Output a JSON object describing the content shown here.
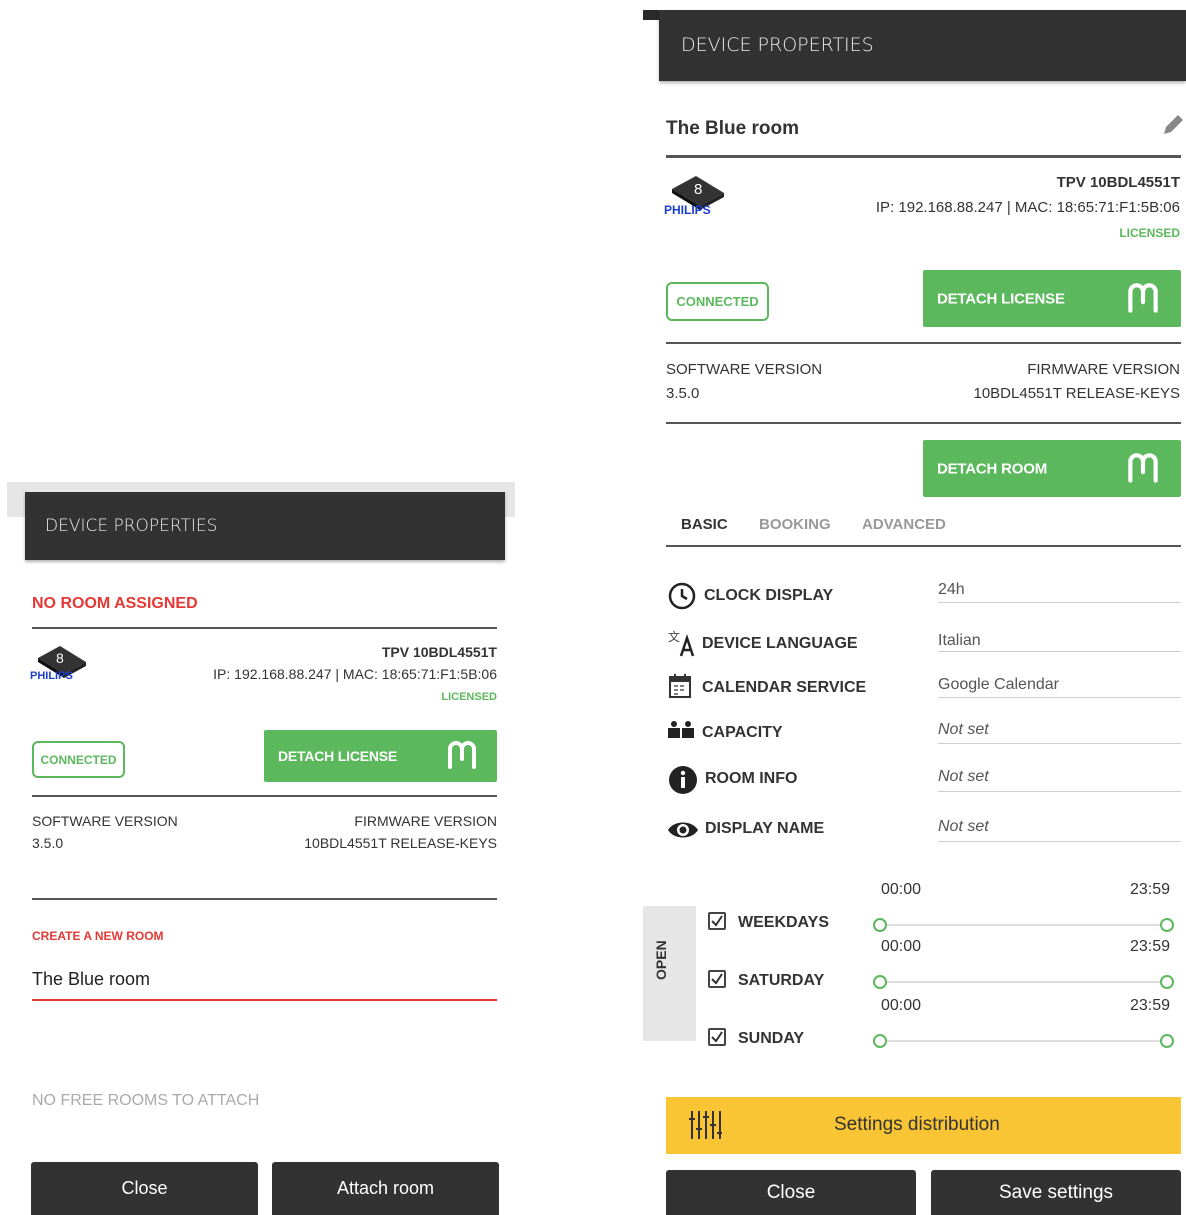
{
  "left_panel": {
    "header_title": "DEVICE PROPERTIES",
    "room_status": "NO ROOM ASSIGNED",
    "device_model": "TPV 10BDL4551T",
    "device_network": "IP: 192.168.88.247 | MAC: 18:65:71:F1:5B:06",
    "license_status": "LICENSED",
    "brand": "PHILIPS",
    "os_badge": "8",
    "connection_badge": "CONNECTED",
    "detach_license_label": "DETACH LICENSE",
    "software_version_label": "SOFTWARE VERSION",
    "software_version_value": "3.5.0",
    "firmware_version_label": "FIRMWARE VERSION",
    "firmware_version_value": "10BDL4551T RELEASE-KEYS",
    "create_room_label": "CREATE A NEW ROOM",
    "create_room_value": "The Blue room",
    "no_free_rooms": "NO FREE ROOMS TO ATTACH",
    "close_label": "Close",
    "attach_room_label": "Attach room"
  },
  "right_panel": {
    "header_title": "DEVICE PROPERTIES",
    "room_name": "The Blue room",
    "device_model": "TPV 10BDL4551T",
    "device_network": "IP: 192.168.88.247 | MAC: 18:65:71:F1:5B:06",
    "license_status": "LICENSED",
    "brand": "PHILIPS",
    "os_badge": "8",
    "connection_badge": "CONNECTED",
    "detach_license_label": "DETACH LICENSE",
    "software_version_label": "SOFTWARE VERSION",
    "software_version_value": "3.5.0",
    "firmware_version_label": "FIRMWARE VERSION",
    "firmware_version_value": "10BDL4551T RELEASE-KEYS",
    "detach_room_label": "DETACH ROOM",
    "tabs": [
      {
        "label": "BASIC",
        "active": true
      },
      {
        "label": "BOOKING",
        "active": false
      },
      {
        "label": "ADVANCED",
        "active": false
      }
    ],
    "properties": [
      {
        "label": "CLOCK DISPLAY",
        "value": "24h",
        "icon": "clock-icon"
      },
      {
        "label": "DEVICE LANGUAGE",
        "value": "Italian",
        "icon": "translate-icon"
      },
      {
        "label": "CALENDAR SERVICE",
        "value": "Google Calendar",
        "icon": "calendar-icon"
      },
      {
        "label": "CAPACITY",
        "value": "Not set",
        "icon": "people-icon"
      },
      {
        "label": "ROOM INFO",
        "value": "Not set",
        "icon": "info-icon"
      },
      {
        "label": "DISPLAY NAME",
        "value": "Not set",
        "icon": "eye-icon"
      }
    ],
    "open_label": "OPEN",
    "schedule": [
      {
        "day": "WEEKDAYS",
        "start": "00:00",
        "end": "23:59",
        "checked": true
      },
      {
        "day": "SATURDAY",
        "start": "00:00",
        "end": "23:59",
        "checked": true
      },
      {
        "day": "SUNDAY",
        "start": "00:00",
        "end": "23:59",
        "checked": true
      }
    ],
    "settings_distribution_label": "Settings distribution",
    "close_label": "Close",
    "save_settings_label": "Save settings"
  },
  "colors": {
    "header_bg": "#323232",
    "accent_green": "#5cb85c",
    "alert_red": "#e53935",
    "yellow": "#f9c534"
  }
}
